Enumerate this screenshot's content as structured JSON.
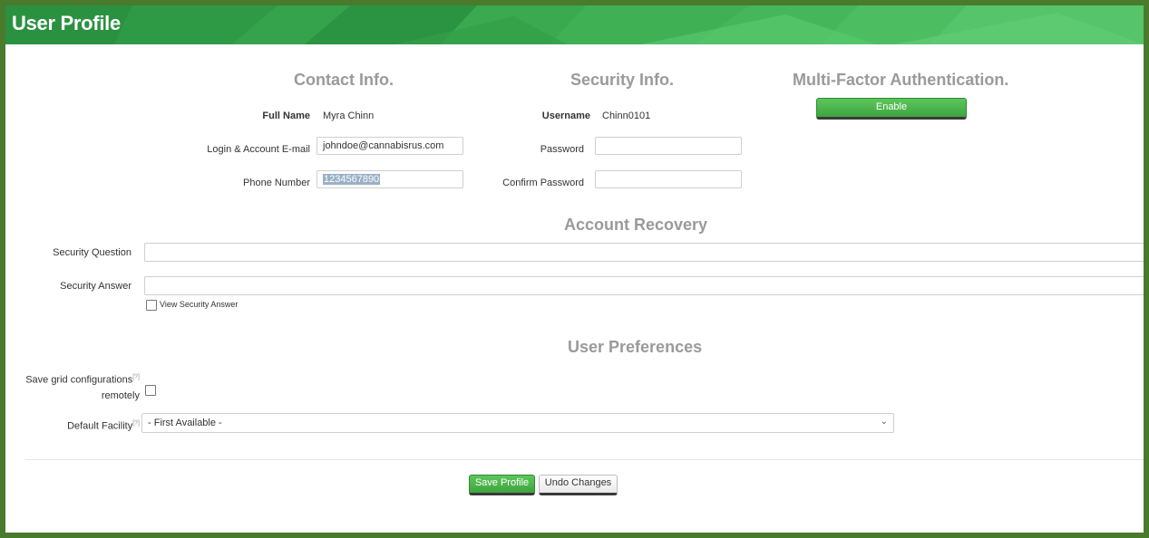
{
  "header": {
    "title": "User Profile"
  },
  "contact": {
    "title": "Contact Info.",
    "full_name_label": "Full Name",
    "full_name_value": "Myra Chinn",
    "email_label": "Login & Account E-mail",
    "email_value": "johndoe@cannabisrus.com",
    "phone_label": "Phone Number",
    "phone_value": "1234567890"
  },
  "security": {
    "title": "Security Info.",
    "username_label": "Username",
    "username_value": "Chinn0101",
    "password_label": "Password",
    "password_value": "",
    "confirm_label": "Confirm Password",
    "confirm_value": ""
  },
  "mfa": {
    "title": "Multi-Factor Authentication.",
    "enable_label": "Enable"
  },
  "recovery": {
    "title": "Account Recovery",
    "question_label": "Security Question",
    "question_value": "",
    "answer_label": "Security Answer",
    "answer_value": "",
    "view_answer_label": "View Security Answer"
  },
  "preferences": {
    "title": "User Preferences",
    "save_grid_label_line1": "Save grid configurations",
    "save_grid_label_line2": "remotely",
    "help_marker": "[?]",
    "default_facility_label": "Default Facility",
    "default_facility_value": "- First Available -"
  },
  "actions": {
    "save_label": "Save Profile",
    "undo_label": "Undo Changes"
  },
  "colors": {
    "header_green": "#2f9a45",
    "button_green": "#4cb34c",
    "frame_border": "#4a7a2c"
  }
}
